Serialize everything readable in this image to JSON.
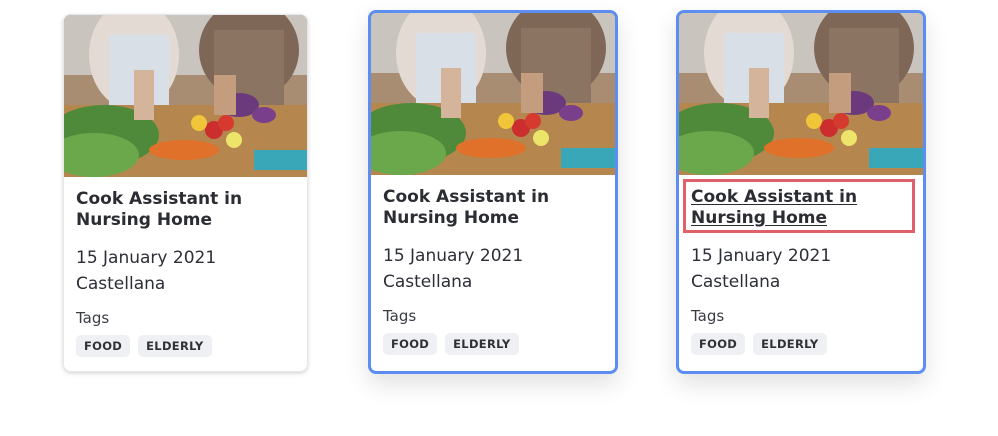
{
  "cards": [
    {
      "title": "Cook Assistant in Nursing Home",
      "date": "15 January 2021",
      "location": "Castellana",
      "tags_label": "Tags",
      "tags": [
        "FOOD",
        "ELDERLY"
      ]
    },
    {
      "title": "Cook Assistant in Nursing Home",
      "date": "15 January 2021",
      "location": "Castellana",
      "tags_label": "Tags",
      "tags": [
        "FOOD",
        "ELDERLY"
      ]
    },
    {
      "title": "Cook Assistant in Nursing Home",
      "date": "15 January 2021",
      "location": "Castellana",
      "tags_label": "Tags",
      "tags": [
        "FOOD",
        "ELDERLY"
      ]
    }
  ],
  "colors": {
    "accent_border": "#5b8ef0",
    "focus_highlight": "#e0616b",
    "tag_bg": "#eef0f4"
  },
  "icons": {
    "card_image": "cooking-photo"
  }
}
